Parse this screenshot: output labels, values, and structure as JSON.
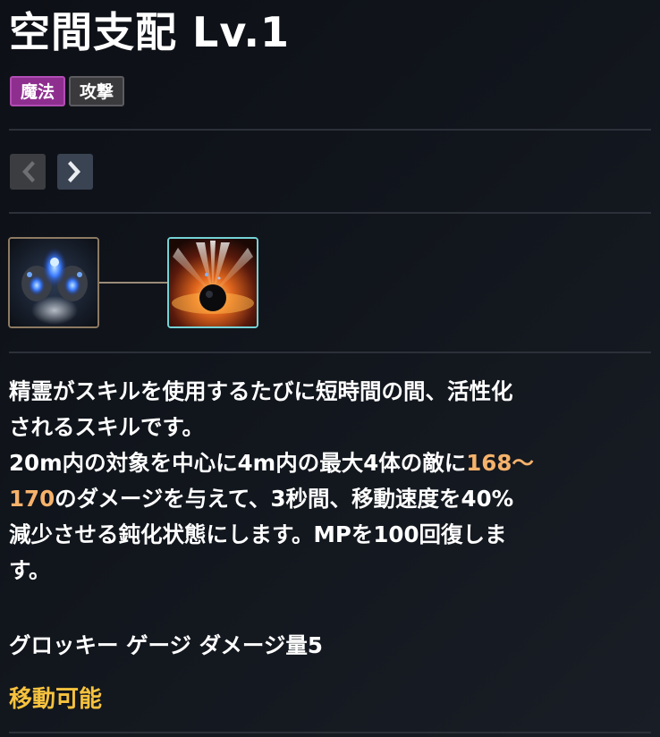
{
  "skill": {
    "title": "空間支配 Lv.1",
    "tags": [
      "魔法",
      "攻撃"
    ],
    "icons": [
      "spirit-hands-icon",
      "dark-sphere-burst-icon"
    ],
    "description": {
      "line1": "精霊がスキルを使用するたびに短時間の間、活性化",
      "line2": "されるスキルです。",
      "line3_pre": "20m内の対象を中心に4m内の最大4体の敵に",
      "line3_hl": "168～",
      "line4_hl": "170",
      "line4_post": "のダメージを与えて、3秒間、移動速度を40%",
      "line5": "減少させる鈍化状態にします。MPを100回復しま",
      "line6": "す。"
    },
    "gauge_text": "グロッキー ゲージ ダメージ量5",
    "movable_text": "移動可能"
  },
  "colors": {
    "tag_magic": "#8e2f8f",
    "tag_attack": "#3a3a3d",
    "highlight": "#f6b26b",
    "movable": "#f7c23e"
  },
  "nav": {
    "prev_icon": "chevron-left-icon",
    "next_icon": "chevron-right-icon"
  }
}
